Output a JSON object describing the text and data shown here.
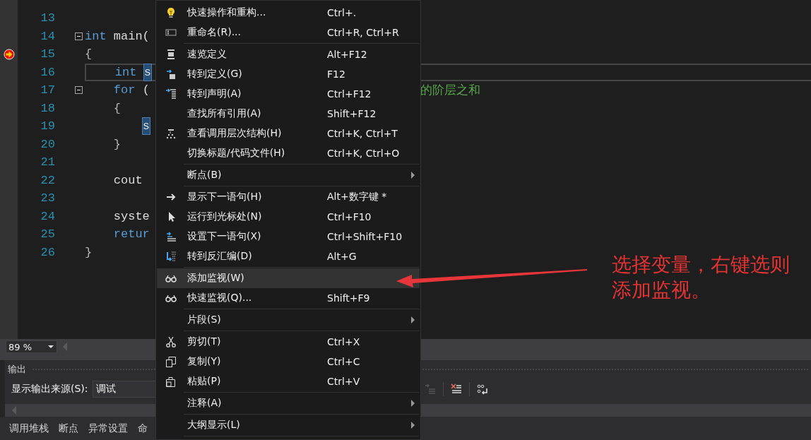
{
  "editor": {
    "lines": [
      {
        "number": "13",
        "current_statement": false,
        "cursor_line": false,
        "foldable": false
      },
      {
        "number": "14",
        "current_statement": false,
        "cursor_line": false,
        "foldable": true,
        "tokens": [
          {
            "kind": "keyword",
            "text": "int"
          },
          {
            "kind": "plain",
            "text": " main("
          }
        ]
      },
      {
        "number": "15",
        "current_statement": true,
        "cursor_line": false,
        "foldable": false,
        "tokens": [
          {
            "kind": "punct",
            "text": "{"
          }
        ]
      },
      {
        "number": "16",
        "current_statement": false,
        "cursor_line": true,
        "foldable": false,
        "tokens": [
          {
            "kind": "keyword",
            "text": "    int "
          },
          {
            "kind": "highlight",
            "text": "s"
          }
        ]
      },
      {
        "number": "17",
        "current_statement": false,
        "cursor_line": false,
        "foldable": true,
        "tokens": [
          {
            "kind": "keyword",
            "text": "    for"
          },
          {
            "kind": "plain",
            "text": " ("
          },
          {
            "kind": "comment",
            "text": "的阶层之和"
          }
        ]
      },
      {
        "number": "18",
        "current_statement": false,
        "cursor_line": false,
        "foldable": false,
        "tokens": [
          {
            "kind": "punct",
            "text": "    {"
          }
        ]
      },
      {
        "number": "19",
        "current_statement": false,
        "cursor_line": false,
        "foldable": false,
        "tokens": [
          {
            "kind": "highlight",
            "text": "        s"
          }
        ]
      },
      {
        "number": "20",
        "current_statement": false,
        "cursor_line": false,
        "foldable": false,
        "tokens": [
          {
            "kind": "punct",
            "text": "    }"
          }
        ]
      },
      {
        "number": "21",
        "current_statement": false,
        "cursor_line": false,
        "foldable": false
      },
      {
        "number": "22",
        "current_statement": false,
        "cursor_line": false,
        "foldable": false,
        "tokens": [
          {
            "kind": "plain",
            "text": "    cout"
          }
        ]
      },
      {
        "number": "23",
        "current_statement": false,
        "cursor_line": false,
        "foldable": false
      },
      {
        "number": "24",
        "current_statement": false,
        "cursor_line": false,
        "foldable": false,
        "tokens": [
          {
            "kind": "plain",
            "text": "    syste"
          }
        ]
      },
      {
        "number": "25",
        "current_statement": false,
        "cursor_line": false,
        "foldable": false,
        "tokens": [
          {
            "kind": "keyword",
            "text": "    retur"
          }
        ]
      },
      {
        "number": "26",
        "current_statement": false,
        "cursor_line": false,
        "foldable": false,
        "tokens": [
          {
            "kind": "punct",
            "text": "}"
          }
        ]
      }
    ]
  },
  "zoom": {
    "value": "89 %"
  },
  "output_panel": {
    "title": "输出",
    "source_label": "显示输出来源(S):",
    "source_value": "调试"
  },
  "bottom_tabs": [
    {
      "label": "调用堆栈"
    },
    {
      "label": "断点"
    },
    {
      "label": "异常设置"
    },
    {
      "label": "命"
    }
  ],
  "context_menu": {
    "items": [
      {
        "kind": "command",
        "label": "快速操作和重构...",
        "shortcut": "Ctrl+.",
        "submenu": false,
        "selected": false
      },
      {
        "kind": "command",
        "label": "重命名(R)...",
        "shortcut": "Ctrl+R, Ctrl+R",
        "submenu": false,
        "selected": false
      },
      {
        "kind": "separator"
      },
      {
        "kind": "command",
        "label": "速览定义",
        "shortcut": "Alt+F12",
        "submenu": false,
        "selected": false
      },
      {
        "kind": "command",
        "label": "转到定义(G)",
        "shortcut": "F12",
        "submenu": false,
        "selected": false
      },
      {
        "kind": "command",
        "label": "转到声明(A)",
        "shortcut": "Ctrl+F12",
        "submenu": false,
        "selected": false
      },
      {
        "kind": "command",
        "label": "查找所有引用(A)",
        "shortcut": "Shift+F12",
        "submenu": false,
        "selected": false
      },
      {
        "kind": "command",
        "label": "查看调用层次结构(H)",
        "shortcut": "Ctrl+K, Ctrl+T",
        "submenu": false,
        "selected": false
      },
      {
        "kind": "command",
        "label": "切换标题/代码文件(H)",
        "shortcut": "Ctrl+K, Ctrl+O",
        "submenu": false,
        "selected": false
      },
      {
        "kind": "separator"
      },
      {
        "kind": "command",
        "label": "断点(B)",
        "submenu": true,
        "selected": false
      },
      {
        "kind": "separator"
      },
      {
        "kind": "command",
        "label": "显示下一语句(H)",
        "shortcut": "Alt+数字键 *",
        "submenu": false,
        "selected": false
      },
      {
        "kind": "command",
        "label": "运行到光标处(N)",
        "shortcut": "Ctrl+F10",
        "submenu": false,
        "selected": false
      },
      {
        "kind": "command",
        "label": "设置下一语句(X)",
        "shortcut": "Ctrl+Shift+F10",
        "submenu": false,
        "selected": false
      },
      {
        "kind": "command",
        "label": "转到反汇编(D)",
        "shortcut": "Alt+G",
        "submenu": false,
        "selected": false
      },
      {
        "kind": "separator"
      },
      {
        "kind": "command",
        "label": "添加监视(W)",
        "submenu": false,
        "selected": true
      },
      {
        "kind": "command",
        "label": "快速监视(Q)...",
        "shortcut": "Shift+F9",
        "submenu": false,
        "selected": false
      },
      {
        "kind": "separator"
      },
      {
        "kind": "command",
        "label": "片段(S)",
        "submenu": true,
        "selected": false
      },
      {
        "kind": "separator"
      },
      {
        "kind": "command",
        "label": "剪切(T)",
        "shortcut": "Ctrl+X",
        "submenu": false,
        "selected": false
      },
      {
        "kind": "command",
        "label": "复制(Y)",
        "shortcut": "Ctrl+C",
        "submenu": false,
        "selected": false
      },
      {
        "kind": "command",
        "label": "粘贴(P)",
        "shortcut": "Ctrl+V",
        "submenu": false,
        "selected": false
      },
      {
        "kind": "separator"
      },
      {
        "kind": "command",
        "label": "注释(A)",
        "submenu": true,
        "selected": false
      },
      {
        "kind": "separator"
      },
      {
        "kind": "command",
        "label": "大纲显示(L)",
        "submenu": true,
        "selected": false
      },
      {
        "kind": "separator"
      }
    ]
  },
  "annotation": {
    "text": "选择变量，右键选则添加监视。"
  }
}
